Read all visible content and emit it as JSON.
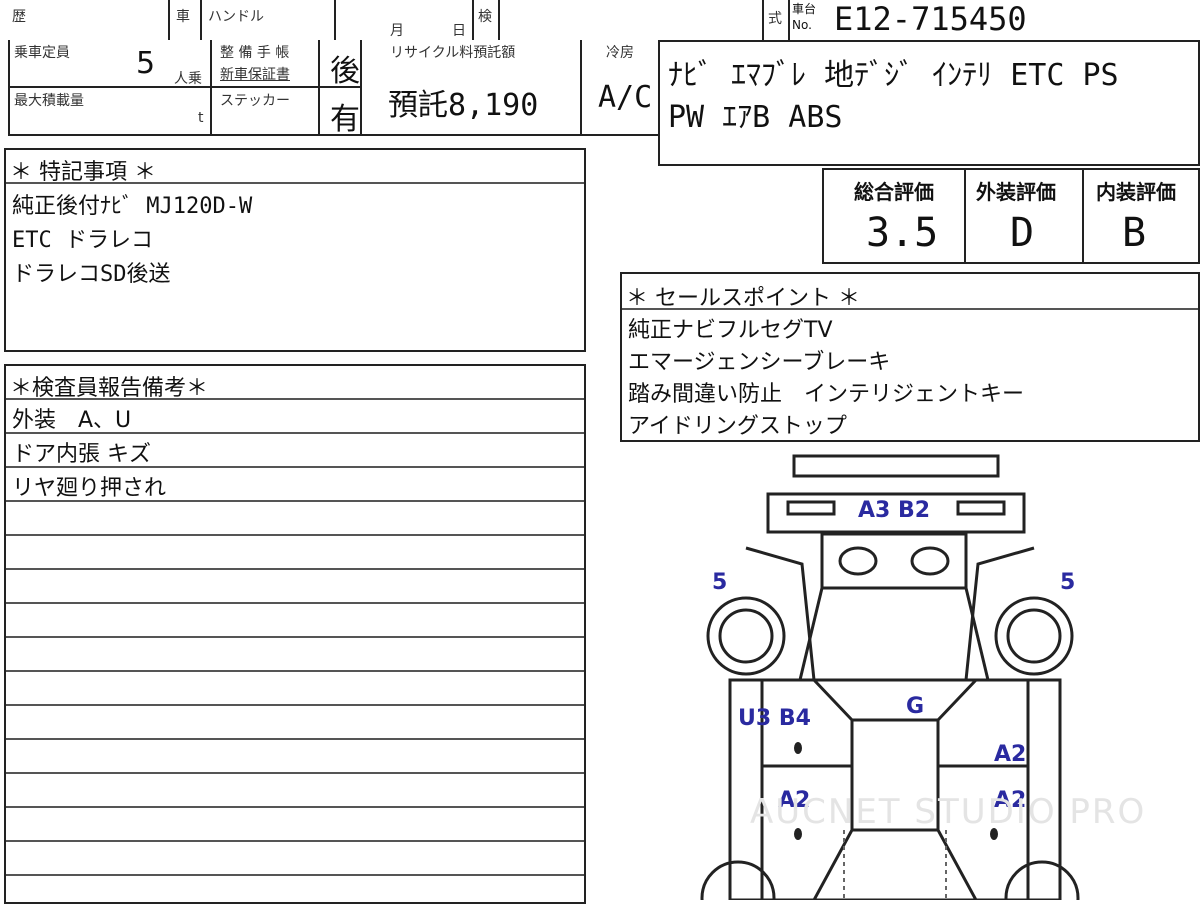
{
  "header": {
    "reki": "歴",
    "sha": "車",
    "handle": "ハンドル",
    "month": "月",
    "day": "日",
    "ken": "検",
    "shiki": "式",
    "car_no_label_1": "車台",
    "car_no_label_2": "No.",
    "car_no": "E12-715450"
  },
  "specs": {
    "capacity_label": "乗車定員",
    "capacity": "5",
    "capacity_unit": "人乗",
    "max_load_label": "最大積載量",
    "max_load_unit": "t",
    "maint_label_1": "整 備 手 帳",
    "maint_label_2": "新車保証書",
    "maint_value": "後",
    "sticker_label": "ステッカー",
    "sticker_value": "有",
    "recycle_label": "リサイクル料預託額",
    "recycle_value": "預託8,190",
    "cooling_label": "冷房",
    "cooling_value": "A/C",
    "equipment_line1": "ﾅﾋﾞ ｴﾏﾌﾞﾚ 地ﾃﾞｼﾞ ｲﾝﾃﾘ ETC PS",
    "equipment_line2": "PW ｴｱB ABS"
  },
  "special_notes": {
    "title": "＊ 特記事項 ＊",
    "lines": [
      "純正後付ﾅﾋﾞ MJ120D-W",
      "ETC ドラレコ",
      "ドラレコSD後送"
    ]
  },
  "inspector_notes": {
    "title": "＊検査員報告備考＊",
    "lines": [
      "外装　A、U",
      "ドア内張 キズ",
      "リヤ廻り押され"
    ]
  },
  "ratings": {
    "overall_label": "総合評価",
    "overall": "3.5",
    "exterior_label": "外装評価",
    "exterior": "D",
    "interior_label": "内装評価",
    "interior": "B"
  },
  "sales_points": {
    "title": "＊ セールスポイント ＊",
    "lines": [
      "純正ナビフルセグTV",
      "エマージェンシーブレーキ",
      "踏み間違い防止　インテリジェントキー",
      "アイドリングストップ"
    ]
  },
  "diagram": {
    "labels": {
      "front_bumper": "A3 B2",
      "front_left": "5",
      "front_right": "5",
      "left_front_door": "U3 B4",
      "roof": "G",
      "right_front_door": "A2",
      "left_rear_door": "A2",
      "right_rear_door": "A2"
    },
    "watermark": "AUCNET STUDIO PRO"
  }
}
